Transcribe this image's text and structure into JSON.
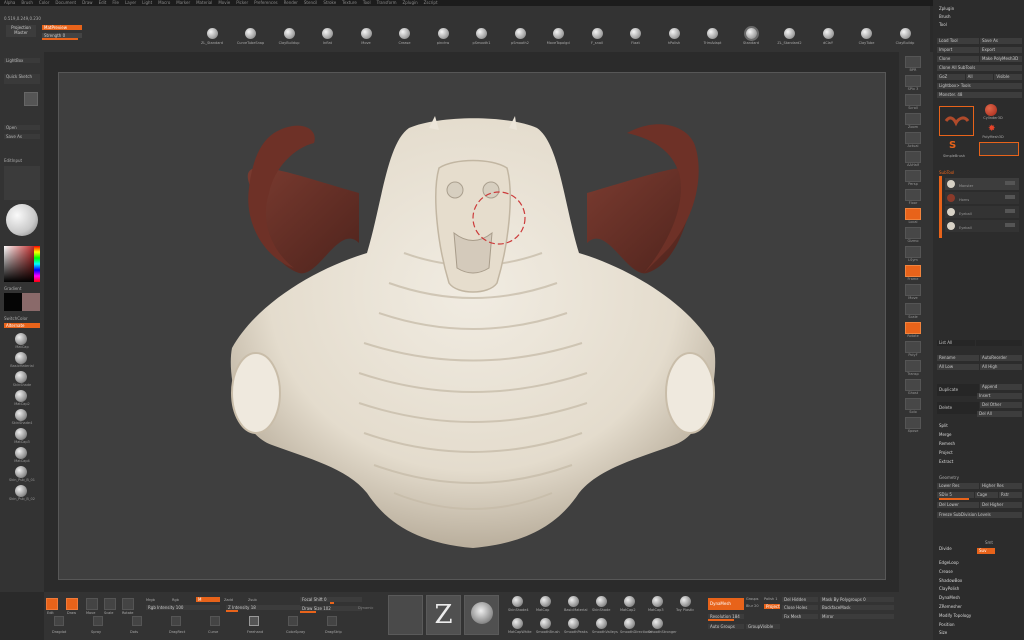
{
  "menu": {
    "items": [
      "Alpha",
      "Brush",
      "Color",
      "Document",
      "Draw",
      "Edit",
      "File",
      "Layer",
      "Light",
      "Macro",
      "Marker",
      "Material",
      "Movie",
      "Picker",
      "Preferences",
      "Render",
      "Stencil",
      "Stroke",
      "Texture",
      "Tool",
      "Transform",
      "Zplugin",
      "Zscript"
    ],
    "quicksave_label": "QuickSave",
    "default_label": "DefaultZScript"
  },
  "toolbar": {
    "coords": "0.519,0.249,0.230",
    "projection_label": "Projection Master",
    "material_label": "MatPreview",
    "strength_label": "Strength 0",
    "brushes": [
      {
        "label": "ZL_Standard",
        "selected": false
      },
      {
        "label": "CurveTubeSnap",
        "selected": false
      },
      {
        "label": "ClayBuildup",
        "selected": false
      },
      {
        "label": "Inflat",
        "selected": false
      },
      {
        "label": "Move",
        "selected": false
      },
      {
        "label": "Crease",
        "selected": false
      },
      {
        "label": "pinchw",
        "selected": false
      },
      {
        "label": "pSmooth1",
        "selected": false
      },
      {
        "label": "pSmooth2",
        "selected": false
      },
      {
        "label": "MoveTopolgcl",
        "selected": false
      },
      {
        "label": "F_snail",
        "selected": false
      },
      {
        "label": "Flaat",
        "selected": false
      },
      {
        "label": "hPolish",
        "selected": false
      },
      {
        "label": "TrimAdapt",
        "selected": false
      },
      {
        "label": "Standard",
        "selected": true
      },
      {
        "label": "ZL_Standard2",
        "selected": false
      },
      {
        "label": "dClaY",
        "selected": false
      },
      {
        "label": "ClayTube",
        "selected": false
      },
      {
        "label": "ClayBuildp",
        "selected": false
      }
    ]
  },
  "left_shelf": {
    "lightbox_label": "LightBox",
    "quicksketch_label": "Quick Sketch",
    "open_label": "Open",
    "saveas_label": "Save As",
    "editinput_label": "EditInput",
    "gradient_label": "Gradient",
    "switchcolor_label": "SwitchColor",
    "alternate_label": "Alternate",
    "materials": [
      "MatCap",
      "BasicMaterial",
      "SkinShade",
      "MatCap2",
      "SkinShade4",
      "MatCap3",
      "MatCap4",
      "Skin_Pub_B_01",
      "Skin_Pub_B_02"
    ]
  },
  "right_column": {
    "labels": [
      "BPR",
      "SPix 3",
      "Scroll",
      "Zoom",
      "Actual",
      "AAHalf",
      "Persp",
      "Floor",
      "Local",
      "Gizmo",
      "LSym",
      "Frame",
      "Move",
      "Scale",
      "Rotate",
      "PolyF",
      "Transp",
      "Ghost",
      "Solo",
      "Xpose"
    ]
  },
  "tray": {
    "header_items": [
      "Zplugin",
      "Brush",
      "Tool"
    ],
    "rows": [
      [
        "Load Tool",
        "Save As"
      ],
      [
        "Import",
        "Export"
      ],
      [
        "Clone",
        "Make PolyMesh3D"
      ],
      [
        "Clone All SubTools"
      ],
      [
        "GoZ",
        "All",
        "Visible"
      ],
      [
        "Lightbox> Tools"
      ],
      [
        "Monster. 48"
      ]
    ],
    "thumb_labels": [
      "Cylinder3D",
      "PolyMesh3D",
      "SimpleBrush"
    ],
    "subtool_label": "SubTool",
    "subtool_items": [
      "Monster",
      "Horns",
      "Eyeball",
      "Eyeball"
    ],
    "list_all_label": "List All",
    "rename_label": "Rename",
    "autoreorder_label": "AutoReorder",
    "all_low_label": "All Low",
    "all_high_label": "All High",
    "duplicate_label": "Duplicate",
    "append_label": "Append",
    "insert_label": "Insert",
    "delete_label": "Delete",
    "del_other_label": "Del Other",
    "del_all_label": "Del All",
    "sections": [
      "Split",
      "Merge",
      "Remesh",
      "Project",
      "Extract"
    ],
    "geometry_label": "Geometry",
    "lower_res_label": "Lower Res",
    "higher_res_label": "Higher Res",
    "sdiv_label": "SDiv 5",
    "cage_label": "Cage",
    "rstr_label": "Rstr",
    "del_lower_label": "Del Lower",
    "del_higher_label": "Del Higher",
    "freeze_label": "Freeze SubDivision Levels",
    "divide_label": "Divide",
    "smt_label": "Smt",
    "suv_label": "Suv",
    "bottom_sections": [
      "EdgeLoop",
      "Crease",
      "ShadowBox",
      "ClayPolish",
      "DynaMesh",
      "ZRemesher",
      "Modify Topology",
      "Position",
      "Size"
    ]
  },
  "bottom": {
    "edit_label": "Edit",
    "draw_label": "Draw",
    "move_label": "Move",
    "scale_label": "Scale",
    "rotate_label": "Rotate",
    "mrgb_label": "Mrgb",
    "rgb_label": "Rgb",
    "m_label": "M",
    "zadd_label": "Zadd",
    "zsub_label": "Zsub",
    "rgb_intensity_label": "Rgb Intensity 100",
    "z_intensity_label": "Z Intensity 18",
    "focal_label": "Focal Shift 0",
    "drawsize_label": "Draw Size 102",
    "dynamic_label": "Dynamic",
    "tool_labels": [
      "Dragdot",
      "Spray",
      "Dots",
      "DragRect",
      "Curve",
      "Freehand",
      "ColorSpray",
      "DragStrip"
    ],
    "mat_labels": [
      "SkinShade4",
      "MatCap",
      "BasicMaterial",
      "SkinShade",
      "MatCap2",
      "MatCap3",
      "Toy Plastic",
      "MatCapWhite",
      "SmoothBrush",
      "SmoothPeaks",
      "SmoothValleys",
      "SmoothDirectional",
      "SmoothStronger"
    ],
    "dynamesh_label": "DynaMesh",
    "resolution_label": "Resolution 184",
    "groups_label": "Groups",
    "polish_label": "Polish 1",
    "blur_label": "Blur 20",
    "project_label": "Project",
    "del_hidden_label": "Del Hidden",
    "close_holes_label": "Close Holes",
    "mask_polygroup_label": "Mask By Polygroups 0",
    "backface_label": "BackfaceMask",
    "fix_mesh_label": "Fix Mesh",
    "mirror_label": "Mirror",
    "auto_groups_label": "Auto Groups",
    "group_visible_label": "GroupVisible"
  }
}
